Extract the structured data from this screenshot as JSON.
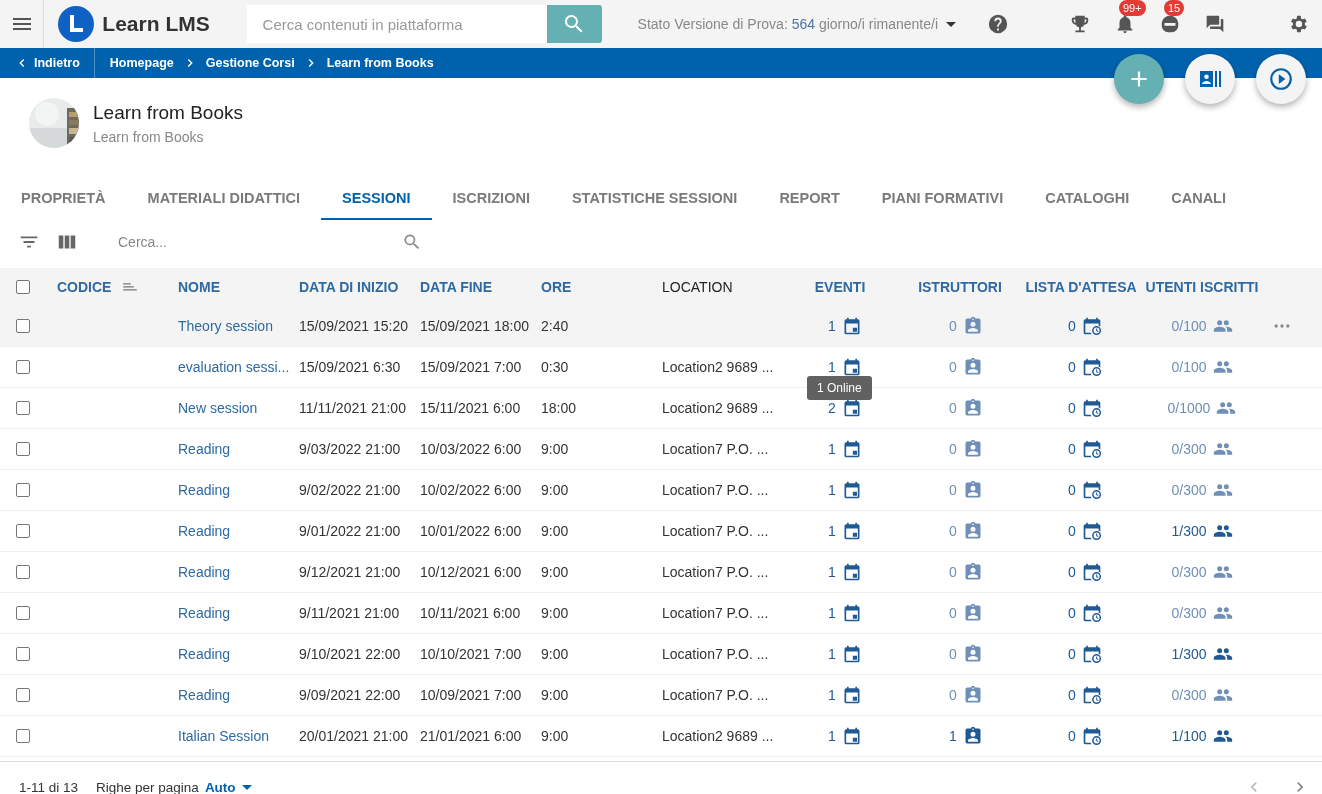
{
  "header": {
    "brand": "Learn LMS",
    "search_placeholder": "Cerca contenuti in piattaforma",
    "trial_label": "Stato Versione di Prova:",
    "trial_days": "564",
    "trial_suffix": "giorno/i rimanente/i",
    "notifications_badge": "99+",
    "bot_badge": "15"
  },
  "breadcrumb": {
    "back": "Indietro",
    "items": [
      "Homepage",
      "Gestione Corsi",
      "Learn from Books"
    ]
  },
  "course": {
    "title": "Learn from Books",
    "subtitle": "Learn from Books"
  },
  "tabs": [
    {
      "label": "PROPRIETÀ",
      "selected": false
    },
    {
      "label": "MATERIALI DIDATTICI",
      "selected": false
    },
    {
      "label": "SESSIONI",
      "selected": true
    },
    {
      "label": "ISCRIZIONI",
      "selected": false
    },
    {
      "label": "STATISTICHE SESSIONI",
      "selected": false
    },
    {
      "label": "REPORT",
      "selected": false
    },
    {
      "label": "PIANI FORMATIVI",
      "selected": false
    },
    {
      "label": "CATALOGHI",
      "selected": false
    },
    {
      "label": "CANALI",
      "selected": false
    }
  ],
  "toolbar": {
    "search_placeholder": "Cerca..."
  },
  "table": {
    "all_checked": false,
    "columns": [
      {
        "label": "CODICE",
        "sortable": true,
        "sorted": true
      },
      {
        "label": "NOME",
        "sortable": true,
        "sorted": false
      },
      {
        "label": "DATA DI INIZIO",
        "sortable": true,
        "sorted": false
      },
      {
        "label": "DATA FINE",
        "sortable": true,
        "sorted": false
      },
      {
        "label": "ORE",
        "sortable": true,
        "sorted": false
      },
      {
        "label": "LOCATION",
        "sortable": false,
        "sorted": false
      },
      {
        "label": "EVENTI",
        "sortable": true,
        "sorted": false
      },
      {
        "label": "ISTRUTTORI",
        "sortable": true,
        "sorted": false
      },
      {
        "label": "LISTA D'ATTESA",
        "sortable": true,
        "sorted": false
      },
      {
        "label": "UTENTI ISCRITTI",
        "sortable": true,
        "sorted": false
      }
    ],
    "rows": [
      {
        "checked": false,
        "hovered": true,
        "name": "Theory session",
        "start": "15/09/2021 15:20",
        "end": "15/09/2021 18:00",
        "hours": "2:40",
        "events": "1",
        "instructors": "0",
        "instructors_active": false,
        "waitlist": "0",
        "enrolled": "0/100",
        "enrolled_active": false
      },
      {
        "checked": false,
        "hovered": false,
        "name": "evaluation sessi...",
        "start": "15/09/2021 6:30",
        "end": "15/09/2021 7:00",
        "hours": "0:30",
        "location": "Location2 9689 ...",
        "events": "1",
        "instructors": "0",
        "instructors_active": false,
        "waitlist": "0",
        "enrolled": "0/100",
        "enrolled_active": false
      },
      {
        "checked": false,
        "hovered": false,
        "name": "New session",
        "start": "11/11/2021 21:00",
        "end": "15/11/2021 6:00",
        "hours": "18:00",
        "location": "Location2 9689 ...",
        "events": "2",
        "instructors": "0",
        "instructors_active": false,
        "waitlist": "0",
        "enrolled": "0/1000",
        "enrolled_active": false
      },
      {
        "checked": false,
        "hovered": false,
        "name": "Reading",
        "start": "9/03/2022 21:00",
        "end": "10/03/2022 6:00",
        "hours": "9:00",
        "location": "Location7 P.O. ...",
        "events": "1",
        "instructors": "0",
        "instructors_active": false,
        "waitlist": "0",
        "enrolled": "0/300",
        "enrolled_active": false
      },
      {
        "checked": false,
        "hovered": false,
        "name": "Reading",
        "start": "9/02/2022 21:00",
        "end": "10/02/2022 6:00",
        "hours": "9:00",
        "location": "Location7 P.O. ...",
        "events": "1",
        "instructors": "0",
        "instructors_active": false,
        "waitlist": "0",
        "enrolled": "0/300",
        "enrolled_active": false
      },
      {
        "checked": false,
        "hovered": false,
        "name": "Reading",
        "start": "9/01/2022 21:00",
        "end": "10/01/2022 6:00",
        "hours": "9:00",
        "location": "Location7 P.O. ...",
        "events": "1",
        "instructors": "0",
        "instructors_active": false,
        "waitlist": "0",
        "enrolled": "1/300",
        "enrolled_active": true
      },
      {
        "checked": false,
        "hovered": false,
        "name": "Reading",
        "start": "9/12/2021 21:00",
        "end": "10/12/2021 6:00",
        "hours": "9:00",
        "location": "Location7 P.O. ...",
        "events": "1",
        "instructors": "0",
        "instructors_active": false,
        "waitlist": "0",
        "enrolled": "0/300",
        "enrolled_active": false
      },
      {
        "checked": false,
        "hovered": false,
        "name": "Reading",
        "start": "9/11/2021 21:00",
        "end": "10/11/2021 6:00",
        "hours": "9:00",
        "location": "Location7 P.O. ...",
        "events": "1",
        "instructors": "0",
        "instructors_active": false,
        "waitlist": "0",
        "enrolled": "0/300",
        "enrolled_active": false
      },
      {
        "checked": false,
        "hovered": false,
        "name": "Reading",
        "start": "9/10/2021 22:00",
        "end": "10/10/2021 7:00",
        "hours": "9:00",
        "location": "Location7 P.O. ...",
        "events": "1",
        "instructors": "0",
        "instructors_active": false,
        "waitlist": "0",
        "enrolled": "1/300",
        "enrolled_active": true
      },
      {
        "checked": false,
        "hovered": false,
        "name": "Reading",
        "start": "9/09/2021 22:00",
        "end": "10/09/2021 7:00",
        "hours": "9:00",
        "location": "Location7 P.O. ...",
        "events": "1",
        "instructors": "0",
        "instructors_active": false,
        "waitlist": "0",
        "enrolled": "0/300",
        "enrolled_active": false
      },
      {
        "checked": false,
        "hovered": false,
        "name": "Italian Session",
        "start": "20/01/2021 21:00",
        "end": "21/01/2021 6:00",
        "hours": "9:00",
        "location": "Location2 9689 ...",
        "events": "1",
        "instructors": "1",
        "instructors_active": true,
        "waitlist": "0",
        "enrolled": "1/100",
        "enrolled_active": true
      }
    ],
    "tooltip": "1 Online"
  },
  "footer": {
    "range": "1-11 di 13",
    "rows_label": "Righe per pagina",
    "rows_value": "Auto"
  }
}
